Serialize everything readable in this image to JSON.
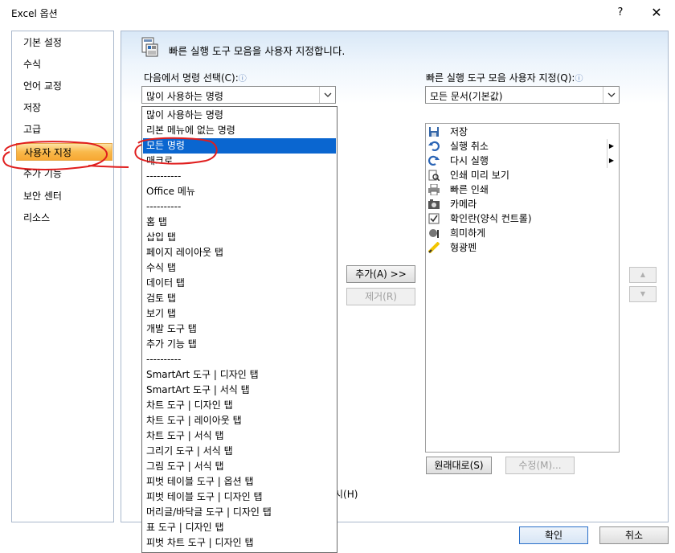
{
  "window": {
    "title": "Excel 옵션",
    "help_glyph": "?",
    "close_glyph": "✕"
  },
  "nav": {
    "items": [
      {
        "label": "기본 설정"
      },
      {
        "label": "수식"
      },
      {
        "label": "언어 교정"
      },
      {
        "label": "저장"
      },
      {
        "label": "고급"
      },
      {
        "label": "사용자 지정",
        "selected": true
      },
      {
        "label": "추가 기능"
      },
      {
        "label": "보안 센터"
      },
      {
        "label": "리소스"
      }
    ]
  },
  "header": {
    "text": "빠른 실행 도구 모음을 사용자 지정합니다.",
    "icon": "quick-access-toolbar-icon"
  },
  "commands": {
    "label": "다음에서 명령 선택(C):",
    "info_glyph": "ⓘ",
    "selected": "많이 사용하는 명령",
    "options": [
      "많이 사용하는 명령",
      "리본 메뉴에 없는 명령",
      "모든 명령",
      "매크로",
      "----------",
      "Office 메뉴",
      "----------",
      "홈 탭",
      "삽입 탭",
      "페이지 레이아웃 탭",
      "수식 탭",
      "데이터 탭",
      "검토 탭",
      "보기 탭",
      "개발 도구 탭",
      "추가 기능 탭",
      "----------",
      "SmartArt 도구 | 디자인 탭",
      "SmartArt 도구 | 서식 탭",
      "차트 도구 | 디자인 탭",
      "차트 도구 | 레이아웃 탭",
      "차트 도구 | 서식 탭",
      "그리기 도구 | 서식 탭",
      "그림 도구 | 서식 탭",
      "피벗 테이블 도구 | 옵션 탭",
      "피벗 테이블 도구 | 디자인 탭",
      "머리글/바닥글 도구 | 디자인 탭",
      "표 도구 | 디자인 탭",
      "피벗 차트 도구 | 디자인 탭"
    ],
    "highlighted_index": 2
  },
  "qat": {
    "label": "빠른 실행 도구 모음 사용자 지정(Q):",
    "info_glyph": "ⓘ",
    "selected": "모든 문서(기본값)",
    "items": [
      {
        "label": "저장",
        "icon": "save-icon"
      },
      {
        "label": "실행 취소",
        "icon": "undo-icon",
        "more": "▶"
      },
      {
        "label": "다시 실행",
        "icon": "redo-icon",
        "more": "▶"
      },
      {
        "label": "인쇄 미리 보기",
        "icon": "print-preview-icon"
      },
      {
        "label": "빠른 인쇄",
        "icon": "quick-print-icon"
      },
      {
        "label": "카메라",
        "icon": "camera-icon"
      },
      {
        "label": "확인란(양식 컨트롤)",
        "icon": "checkbox-icon"
      },
      {
        "label": "희미하게",
        "icon": "dim-icon"
      },
      {
        "label": "형광펜",
        "icon": "highlighter-icon"
      }
    ]
  },
  "buttons": {
    "add": "추가(A) >>",
    "remove": "제거(R)",
    "reset": "원래대로(S)",
    "modify": "수정(M)...",
    "ok": "확인",
    "cancel": "취소",
    "move_up": "▲",
    "move_down": "▼"
  },
  "partial_text": "시(H)"
}
